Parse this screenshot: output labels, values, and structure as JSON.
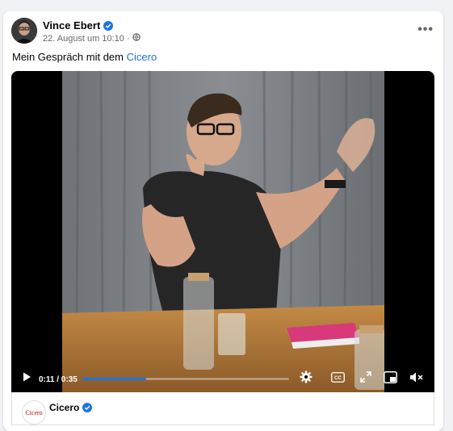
{
  "post": {
    "author": "Vince Ebert",
    "date": "22. August um 10:10",
    "separator": "·",
    "text_prefix": "Mein Gespräch mit dem ",
    "text_link": "Cicero",
    "more_label": "•••"
  },
  "video": {
    "time": "0:11 / 0:35",
    "progress_fraction": 0.31
  },
  "link_card": {
    "name": "Cicero",
    "logo_text": "Cicero"
  },
  "colors": {
    "link": "#216fdb",
    "verified": "#1b74e4",
    "progress": "#1b74e4"
  },
  "icons": [
    "verified-icon",
    "globe-icon",
    "more-icon",
    "play-icon",
    "settings-icon",
    "captions-icon",
    "fullscreen-icon",
    "miniplayer-icon",
    "mute-icon"
  ]
}
